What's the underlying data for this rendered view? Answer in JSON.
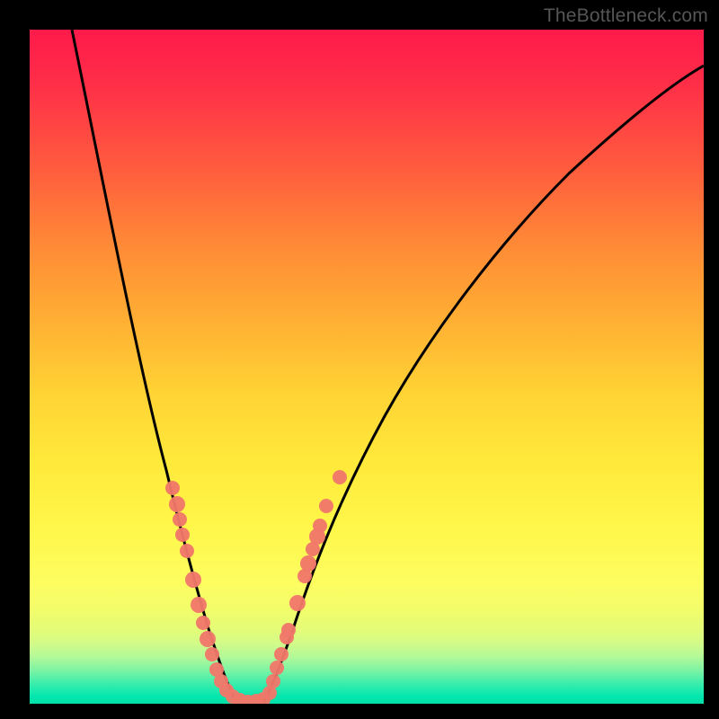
{
  "watermark": "TheBottleneck.com",
  "chart_data": {
    "type": "line",
    "title": "",
    "xlabel": "",
    "ylabel": "",
    "xlim": [
      0,
      100
    ],
    "ylim": [
      0,
      100
    ],
    "grid": false,
    "legend": false,
    "background_gradient": {
      "direction": "top-to-bottom",
      "stops": [
        {
          "pos": 0.0,
          "color": "#ff1a4a"
        },
        {
          "pos": 0.2,
          "color": "#ff5a3e"
        },
        {
          "pos": 0.44,
          "color": "#ffb233"
        },
        {
          "pos": 0.64,
          "color": "#ffe93a"
        },
        {
          "pos": 0.82,
          "color": "#fdfd60"
        },
        {
          "pos": 0.93,
          "color": "#b4f998"
        },
        {
          "pos": 1.0,
          "color": "#00e0a8"
        }
      ]
    },
    "series": [
      {
        "name": "left-curve",
        "type": "line",
        "color": "#000000",
        "x": [
          6,
          12,
          17,
          21,
          24,
          26,
          28,
          30.5
        ],
        "y": [
          100,
          72,
          50,
          32,
          18,
          9,
          3,
          0.3
        ]
      },
      {
        "name": "right-curve",
        "type": "line",
        "color": "#000000",
        "x": [
          34.5,
          38,
          44,
          52,
          60,
          70,
          80,
          90,
          100
        ],
        "y": [
          0.2,
          8,
          25,
          42,
          55,
          68,
          79,
          88,
          94
        ]
      },
      {
        "name": "scatter-points",
        "type": "scatter",
        "color": "#f0786a",
        "x": [
          21.2,
          21.9,
          22.3,
          22.7,
          23.3,
          24.3,
          25.1,
          25.7,
          26.4,
          27.1,
          27.7,
          28.4,
          29.2,
          30.1,
          31.2,
          32.4,
          33.6,
          34.7,
          35.6,
          36.1,
          36.7,
          37.3,
          38.1,
          38.4,
          39.7,
          40.8,
          41.3,
          42.0,
          42.7,
          43.1,
          44.0,
          46.0
        ],
        "y": [
          32.0,
          29.6,
          27.3,
          25.1,
          22.7,
          18.4,
          14.7,
          12.0,
          9.6,
          7.3,
          5.1,
          3.3,
          2.0,
          1.1,
          0.5,
          0.3,
          0.4,
          0.7,
          1.6,
          3.3,
          5.3,
          7.3,
          9.9,
          10.9,
          14.9,
          18.9,
          20.8,
          22.9,
          24.8,
          26.4,
          29.3,
          33.6
        ]
      }
    ]
  }
}
